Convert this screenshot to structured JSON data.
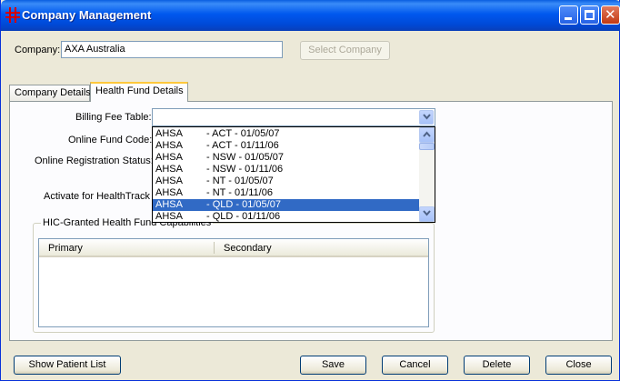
{
  "window": {
    "title": "Company Management"
  },
  "company": {
    "label": "Company:",
    "value": "AXA Australia",
    "select_button": "Select Company"
  },
  "tabs": [
    {
      "label": "Company Details",
      "active": false
    },
    {
      "label": "Health Fund Details",
      "active": true
    }
  ],
  "fields": {
    "billing_fee_table": "Billing Fee Table:",
    "online_fund_code": "Online Fund Code:",
    "online_registration_status": "Online Registration Status:",
    "activate_healthtrack": "Activate for HealthTrack"
  },
  "dropdown": {
    "value": "",
    "items": [
      {
        "code": "AHSA",
        "desc": "- ACT - 01/05/07",
        "selected": false
      },
      {
        "code": "AHSA",
        "desc": "- ACT - 01/11/06",
        "selected": false
      },
      {
        "code": "AHSA",
        "desc": "- NSW - 01/05/07",
        "selected": false
      },
      {
        "code": "AHSA",
        "desc": "- NSW - 01/11/06",
        "selected": false
      },
      {
        "code": "AHSA",
        "desc": "- NT - 01/05/07",
        "selected": false
      },
      {
        "code": "AHSA",
        "desc": "- NT - 01/11/06",
        "selected": false
      },
      {
        "code": "AHSA",
        "desc": "- QLD - 01/05/07",
        "selected": true
      },
      {
        "code": "AHSA",
        "desc": "- QLD - 01/11/06",
        "selected": false
      }
    ]
  },
  "capabilities": {
    "group_label": "HIC-Granted Health Fund Capabilities",
    "columns": [
      "Primary",
      "Secondary"
    ]
  },
  "buttons": {
    "show_patient_list": "Show Patient List",
    "save": "Save",
    "cancel": "Cancel",
    "delete": "Delete",
    "close": "Close"
  },
  "colors": {
    "titlebar": "#0058ee",
    "selection": "#316ac5",
    "tab_highlight": "#ffc83c",
    "app_icon": "#d40000"
  },
  "icons": {
    "app": "app-logo-icon",
    "minimize": "minimize-icon",
    "maximize": "maximize-icon",
    "close": "close-icon",
    "combo": "chevron-down-icon"
  }
}
